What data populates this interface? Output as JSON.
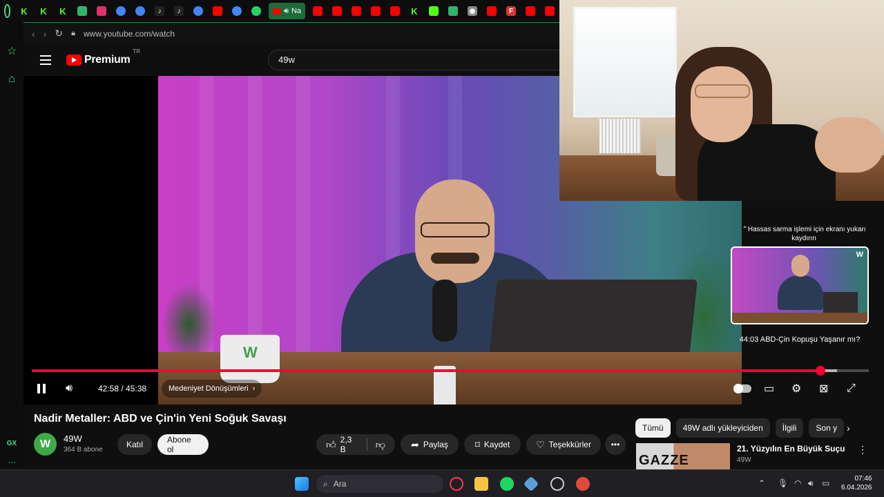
{
  "browser": {
    "url": "www.youtube.com/watch",
    "active_tab_label": "Na",
    "tabs": [
      "kick-icon",
      "kick-icon",
      "kick-icon",
      "app-icon",
      "instagram-icon",
      "chrome-icon",
      "chrome-icon",
      "tiktok-icon",
      "tiktok-icon",
      "chrome-icon",
      "youtube-icon",
      "chrome-icon",
      "whatsapp-icon",
      "youtube-icon",
      "youtube-icon",
      "youtube-icon",
      "youtube-icon",
      "youtube-icon",
      "kick-icon",
      "document-icon",
      "app-icon",
      "github-icon",
      "youtube-icon",
      "font-icon",
      "youtube-icon",
      "youtube-icon"
    ],
    "sidebar_bottom_label": "GX"
  },
  "youtube": {
    "logo_text": "Premium",
    "logo_region": "TR",
    "search_value": "49w"
  },
  "player": {
    "current_time": "42:58",
    "duration": "45:38",
    "time_display": "42:58 / 45:38",
    "chapter": "Medeniyet Dönüşümleri",
    "progress_fraction": 0.942,
    "hover_fraction": 0.962,
    "scrub_hint": "Hassas sarma işlemi için ekranı yukarı kaydırın",
    "scrub_time": "44:03",
    "scrub_chapter": "ABD-Çin Kopuşu Yaşanır mı?",
    "scrub_label": "44:03   ABD-Çin Kopuşu Yaşanır mı?",
    "accent": "#ff0033"
  },
  "video": {
    "title": "Nadir Metaller: ABD ve Çin'in Yeni Soğuk Savaşı",
    "channel": "49W",
    "subscribers": "364 B abone",
    "join_label": "Katıl",
    "subscribe_label": "Abone ol",
    "likes": "2,3 B",
    "share_label": "Paylaş",
    "save_label": "Kaydet",
    "thanks_label": "Teşekkürler",
    "more_label": "•••"
  },
  "recommendations": {
    "chips": [
      "Tümü",
      "49W adlı yükleyiciden",
      "İlgili",
      "Son y"
    ],
    "items": [
      {
        "title": "21. Yüzyılın En Büyük Suçu",
        "channel": "49W",
        "thumb_text": "GAZZE"
      }
    ]
  },
  "taskbar": {
    "search_placeholder": "Ara",
    "time": "07:46",
    "date": "6.04.2026"
  }
}
